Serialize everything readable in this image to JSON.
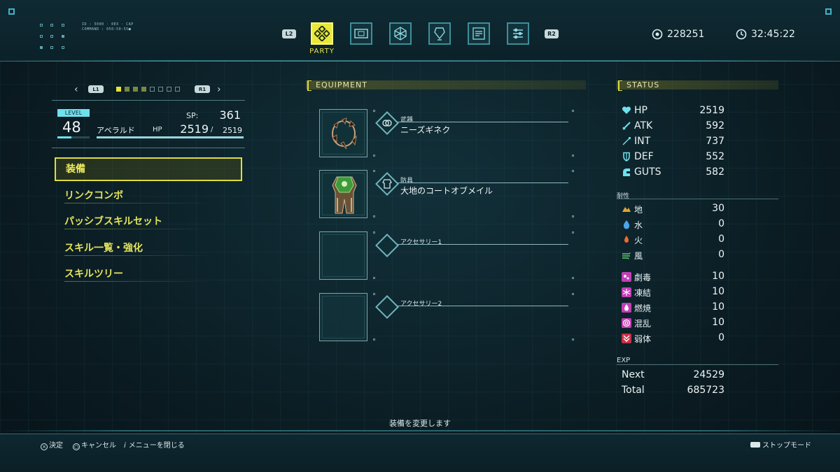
{
  "header": {
    "tiny_line1": "ID : 5000 · 0EX · CAP",
    "tiny_line2": "COMMAND : 050:50:55■",
    "left_shoulder": "L2",
    "right_shoulder": "R2",
    "active_tab_label": "PARTY",
    "tabs": [
      {
        "icon": "party-icon",
        "active": true
      },
      {
        "icon": "card-icon",
        "active": false
      },
      {
        "icon": "skill-network-icon",
        "active": false
      },
      {
        "icon": "crystal-icon",
        "active": false
      },
      {
        "icon": "document-icon",
        "active": false
      },
      {
        "icon": "settings-list-icon",
        "active": false
      }
    ],
    "money": "228251",
    "playtime": "32:45:22"
  },
  "character": {
    "pager_left": "L1",
    "pager_right": "R1",
    "level_tag": "LEVEL",
    "level": "48",
    "name": "アベラルド",
    "sp_label": "SP:",
    "sp": "361",
    "hp_label": "HP",
    "hp_current": "2519",
    "hp_sep": "/",
    "hp_max": "2519",
    "hp_fraction": 1.0
  },
  "menu": [
    {
      "label": "装備",
      "selected": true
    },
    {
      "label": "リンクコンボ",
      "selected": false
    },
    {
      "label": "パッシブスキルセット",
      "selected": false
    },
    {
      "label": "スキル一覧・強化",
      "selected": false
    },
    {
      "label": "スキルツリー",
      "selected": false
    }
  ],
  "equipment": {
    "title": "EQUIPMENT",
    "slots": [
      {
        "type": "武器",
        "name": "ニーズギネク"
      },
      {
        "type": "防具",
        "name": "大地のコートオブメイル"
      },
      {
        "type": "アクセサリー1",
        "name": ""
      },
      {
        "type": "アクセサリー2",
        "name": ""
      }
    ]
  },
  "status": {
    "title": "STATUS",
    "stats": [
      {
        "label": "HP",
        "value": "2519",
        "icon": "heart-icon"
      },
      {
        "label": "ATK",
        "value": "592",
        "icon": "sword-icon"
      },
      {
        "label": "INT",
        "value": "737",
        "icon": "wand-icon"
      },
      {
        "label": "DEF",
        "value": "552",
        "icon": "shield-icon"
      },
      {
        "label": "GUTS",
        "value": "582",
        "icon": "fist-icon"
      }
    ],
    "resist_title": "耐性",
    "elements": [
      {
        "label": "地",
        "value": "30",
        "icon": "earth-icon",
        "color": "#e0a53a"
      },
      {
        "label": "水",
        "value": "0",
        "icon": "water-icon",
        "color": "#4aa6e8"
      },
      {
        "label": "火",
        "value": "0",
        "icon": "fire-icon",
        "color": "#f06a2a"
      },
      {
        "label": "風",
        "value": "0",
        "icon": "wind-icon",
        "color": "#5fcf6a"
      }
    ],
    "ailments": [
      {
        "label": "劇毒",
        "value": "10",
        "icon": "poison-icon",
        "color": "#c23fb5"
      },
      {
        "label": "凍結",
        "value": "10",
        "icon": "freeze-icon",
        "color": "#c23fb5"
      },
      {
        "label": "燃焼",
        "value": "10",
        "icon": "burn-icon",
        "color": "#c23fb5"
      },
      {
        "label": "混乱",
        "value": "10",
        "icon": "confusion-icon",
        "color": "#c23fb5"
      },
      {
        "label": "弱体",
        "value": "0",
        "icon": "weaken-icon",
        "color": "#c9304a"
      }
    ],
    "exp_title": "EXP",
    "next_label": "Next",
    "next_value": "24529",
    "total_label": "Total",
    "total_value": "685723"
  },
  "hint": "装備を変更します",
  "footer": {
    "confirm": "決定",
    "cancel": "キャンセル",
    "close": "メニューを閉じる",
    "stop_mode": "ストップモード"
  },
  "colors": {
    "accent_yellow": "#e5e33e",
    "accent_cyan": "#6ee1ee",
    "background": "#0b1c22"
  }
}
